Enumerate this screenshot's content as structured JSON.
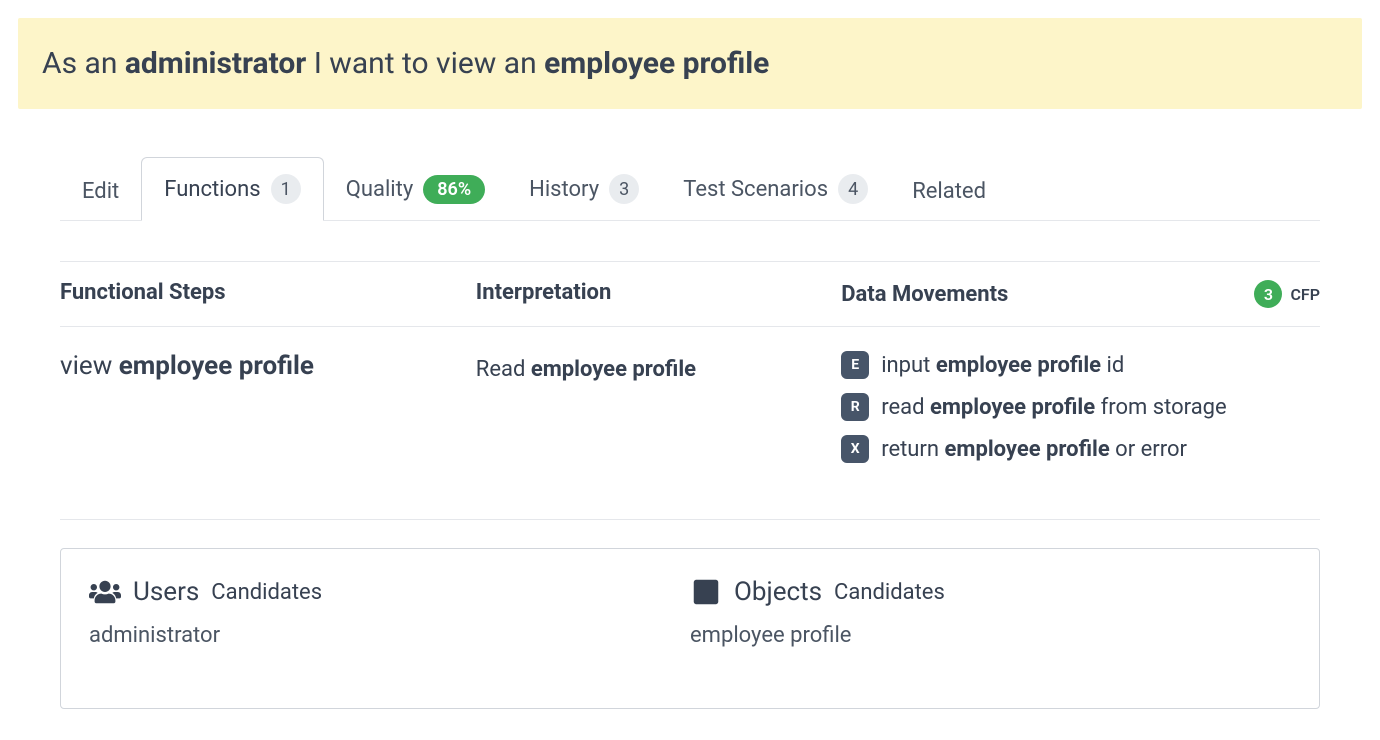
{
  "banner": {
    "prefix": "As an ",
    "role": "administrator",
    "middle": " I want to view an ",
    "object": "employee profile"
  },
  "tabs": {
    "edit": "Edit",
    "functions": {
      "label": "Functions",
      "count": "1"
    },
    "quality": {
      "label": "Quality",
      "badge": "86%"
    },
    "history": {
      "label": "History",
      "count": "3"
    },
    "testScenarios": {
      "label": "Test Scenarios",
      "count": "4"
    },
    "related": "Related"
  },
  "headers": {
    "steps": "Functional Steps",
    "interpretation": "Interpretation",
    "movements": "Data Movements",
    "cfpCount": "3",
    "cfpLabel": "CFP"
  },
  "row": {
    "step": {
      "verb": "view ",
      "obj": "employee profile"
    },
    "interpretation": {
      "verb": "Read ",
      "obj": "employee profile"
    },
    "movements": [
      {
        "tag": "E",
        "pre": "input ",
        "obj": "employee profile",
        "post": " id"
      },
      {
        "tag": "R",
        "pre": "read ",
        "obj": "employee profile",
        "post": " from storage"
      },
      {
        "tag": "X",
        "pre": "return ",
        "obj": "employee profile",
        "post": " or error"
      }
    ]
  },
  "candidates": {
    "usersTitle": "Users",
    "usersSub": "Candidates",
    "usersValue": "administrator",
    "objectsTitle": "Objects",
    "objectsSub": "Candidates",
    "objectsValue": "employee profile"
  }
}
